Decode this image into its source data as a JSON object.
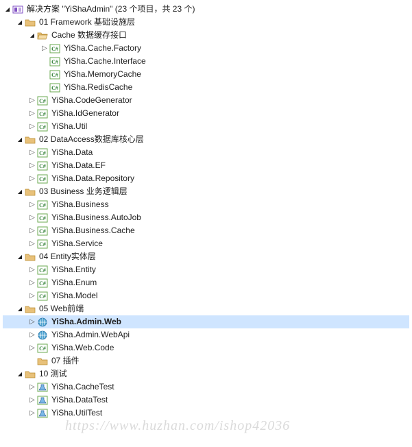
{
  "solution": {
    "label": "解决方案 \"YiShaAdmin\" (23 个项目，共 23 个)"
  },
  "tree": [
    {
      "depth": 0,
      "glyph": "down",
      "icon": "solution",
      "bind": "solution.label"
    },
    {
      "depth": 1,
      "glyph": "down",
      "icon": "folder",
      "text": "01 Framework 基础设施层"
    },
    {
      "depth": 2,
      "glyph": "down",
      "icon": "folder-open",
      "text": "Cache 数据缓存接口"
    },
    {
      "depth": 3,
      "glyph": "right",
      "icon": "csproj",
      "text": "YiSha.Cache.Factory"
    },
    {
      "depth": 3,
      "glyph": "none",
      "icon": "csproj",
      "text": "YiSha.Cache.Interface"
    },
    {
      "depth": 3,
      "glyph": "none",
      "icon": "csproj",
      "text": "YiSha.MemoryCache"
    },
    {
      "depth": 3,
      "glyph": "none",
      "icon": "csproj",
      "text": "YiSha.RedisCache"
    },
    {
      "depth": 2,
      "glyph": "right",
      "icon": "csproj",
      "text": "YiSha.CodeGenerator"
    },
    {
      "depth": 2,
      "glyph": "right",
      "icon": "csproj",
      "text": "YiSha.IdGenerator"
    },
    {
      "depth": 2,
      "glyph": "right",
      "icon": "csproj",
      "text": "YiSha.Util"
    },
    {
      "depth": 1,
      "glyph": "down",
      "icon": "folder",
      "text": "02 DataAccess数据库核心层"
    },
    {
      "depth": 2,
      "glyph": "right",
      "icon": "csproj",
      "text": "YiSha.Data"
    },
    {
      "depth": 2,
      "glyph": "right",
      "icon": "csproj",
      "text": "YiSha.Data.EF"
    },
    {
      "depth": 2,
      "glyph": "right",
      "icon": "csproj",
      "text": "YiSha.Data.Repository"
    },
    {
      "depth": 1,
      "glyph": "down",
      "icon": "folder",
      "text": "03 Business 业务逻辑层"
    },
    {
      "depth": 2,
      "glyph": "right",
      "icon": "csproj",
      "text": "YiSha.Business"
    },
    {
      "depth": 2,
      "glyph": "right",
      "icon": "csproj",
      "text": "YiSha.Business.AutoJob"
    },
    {
      "depth": 2,
      "glyph": "right",
      "icon": "csproj",
      "text": "YiSha.Business.Cache"
    },
    {
      "depth": 2,
      "glyph": "right",
      "icon": "csproj",
      "text": "YiSha.Service"
    },
    {
      "depth": 1,
      "glyph": "down",
      "icon": "folder",
      "text": "04 Entity实体层"
    },
    {
      "depth": 2,
      "glyph": "right",
      "icon": "csproj",
      "text": "YiSha.Entity"
    },
    {
      "depth": 2,
      "glyph": "right",
      "icon": "csproj",
      "text": "YiSha.Enum"
    },
    {
      "depth": 2,
      "glyph": "right",
      "icon": "csproj",
      "text": "YiSha.Model"
    },
    {
      "depth": 1,
      "glyph": "down",
      "icon": "folder",
      "text": "05 Web前端"
    },
    {
      "depth": 2,
      "glyph": "right",
      "icon": "webproj",
      "text": "YiSha.Admin.Web",
      "selected": true,
      "bold": true
    },
    {
      "depth": 2,
      "glyph": "right",
      "icon": "webproj",
      "text": "YiSha.Admin.WebApi"
    },
    {
      "depth": 2,
      "glyph": "right",
      "icon": "csproj",
      "text": "YiSha.Web.Code"
    },
    {
      "depth": 2,
      "glyph": "none",
      "icon": "folder",
      "text": "07 插件"
    },
    {
      "depth": 1,
      "glyph": "down",
      "icon": "folder",
      "text": "10 测试"
    },
    {
      "depth": 2,
      "glyph": "right",
      "icon": "testproj",
      "text": "YiSha.CacheTest"
    },
    {
      "depth": 2,
      "glyph": "right",
      "icon": "testproj",
      "text": "YiSha.DataTest"
    },
    {
      "depth": 2,
      "glyph": "right",
      "icon": "testproj",
      "text": "YiSha.UtilTest"
    }
  ],
  "watermark": "https://www.huzhan.com/ishop42036"
}
